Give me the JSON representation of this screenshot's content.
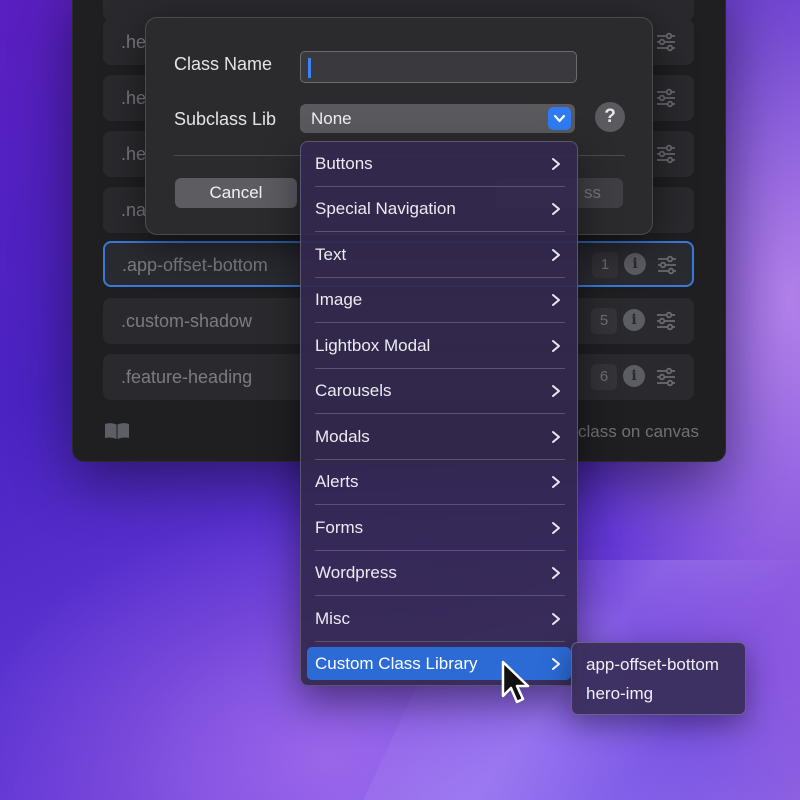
{
  "classes": [
    {
      "name": ".he",
      "count": "",
      "selected": false
    },
    {
      "name": ".he",
      "count": "",
      "selected": false
    },
    {
      "name": ".he",
      "count": "",
      "selected": false
    },
    {
      "name": ".na",
      "count": "",
      "selected": false
    },
    {
      "name": ".app-offset-bottom",
      "count": "1",
      "selected": true
    },
    {
      "name": ".custom-shadow",
      "count": "5",
      "selected": false
    },
    {
      "name": ".feature-heading",
      "count": "6",
      "selected": false
    }
  ],
  "footer": {
    "hint": "class on canvas"
  },
  "dialog": {
    "class_name_label": "Class Name",
    "class_name_value": "",
    "subclass_label": "Subclass Lib",
    "subclass_value": "None",
    "help_glyph": "?",
    "cancel_label": "Cancel",
    "create_label_visible": "ss"
  },
  "menu": {
    "items": [
      {
        "label": "Buttons"
      },
      {
        "label": "Special Navigation"
      },
      {
        "label": "Text"
      },
      {
        "label": "Image"
      },
      {
        "label": "Lightbox Modal"
      },
      {
        "label": "Carousels"
      },
      {
        "label": "Modals"
      },
      {
        "label": "Alerts"
      },
      {
        "label": "Forms"
      },
      {
        "label": "Wordpress"
      },
      {
        "label": "Misc"
      },
      {
        "label": "Custom Class Library"
      }
    ],
    "active_item": "Custom Class Library",
    "arrow_glyph": "›"
  },
  "submenu": {
    "items": [
      {
        "label": "app-offset-bottom"
      },
      {
        "label": "hero-img"
      }
    ]
  },
  "colors": {
    "accent": "#2f7bf5",
    "menu_active": "#2c6bd6",
    "selected_border": "#3a79dc"
  },
  "icons": [
    "info-icon",
    "sliders-icon",
    "book-icon",
    "chevron-down-icon",
    "help-icon",
    "chevron-right-icon",
    "mouse-cursor-icon"
  ]
}
